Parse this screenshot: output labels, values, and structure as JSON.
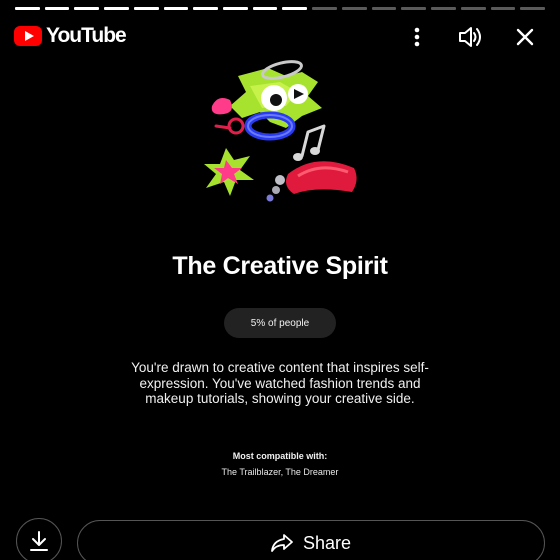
{
  "progress": {
    "completed_segments": 10,
    "total_segments": 18
  },
  "header": {
    "brand": "YouTube",
    "icons": [
      "youtube-logo-icon",
      "more-vert-icon",
      "volume-icon",
      "close-icon"
    ]
  },
  "card": {
    "title": "The Creative Spirit",
    "percent_badge": "5% of people",
    "description": "You're drawn to creative content that inspires self-expression. You've watched fashion trends and makeup tutorials, showing your creative side.",
    "compatible_label": "Most compatible with:",
    "compatible_value": "The Trailblazer, The Dreamer"
  },
  "actions": {
    "share_label": "Share",
    "download_icon": "download-icon",
    "share_icon": "share-arrow-icon"
  },
  "colors": {
    "brand_red": "#ff0000",
    "background": "#000000",
    "pill_bg": "#222222"
  }
}
